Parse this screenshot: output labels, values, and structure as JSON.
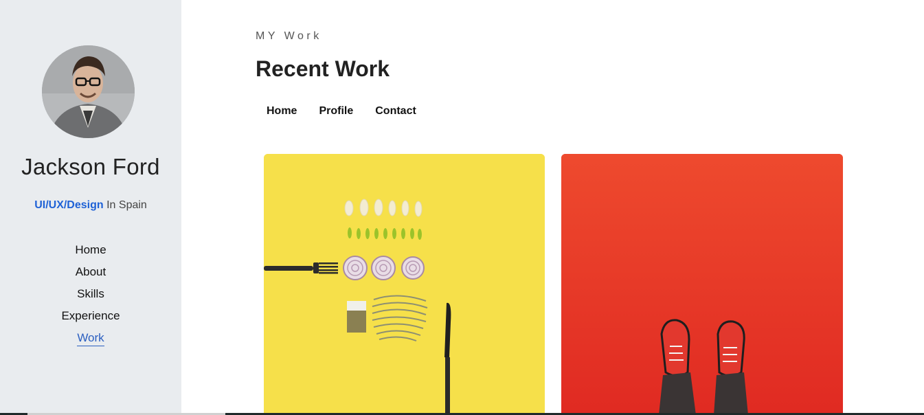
{
  "sidebar": {
    "name": "Jackson Ford",
    "role_accent": "UI/UX/Design",
    "role_rest": " In Spain",
    "nav": [
      "Home",
      "About",
      "Skills",
      "Experience",
      "Work"
    ],
    "active_nav": "Work"
  },
  "main": {
    "eyebrow": "MY Work",
    "heading": "Recent Work",
    "top_nav": [
      "Home",
      "Profile",
      "Contact"
    ]
  },
  "colors": {
    "sidebar_bg": "#e9ecef",
    "accent": "#1f62d6",
    "card_yellow": "#f6e04a",
    "card_red": "#e8392a"
  }
}
